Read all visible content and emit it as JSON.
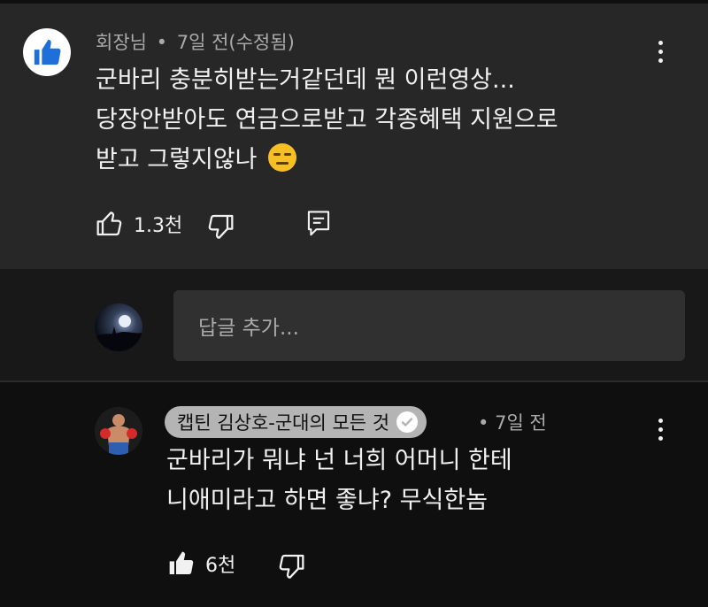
{
  "comment": {
    "author": "회장님",
    "separator": "•",
    "time": "7일 전(수정됨)",
    "lines": [
      "군바리 충분히받는거같던데 뭔 이런영상...",
      "당장안받아도 연금으로받고 각종혜택 지원으로",
      "받고 그렇지않나"
    ],
    "like_count": "1.3천",
    "avatar_icon": "thumbs-up-icon",
    "avatar_color": "#1e6fd9"
  },
  "reply_input": {
    "placeholder": "답글 추가..."
  },
  "reply": {
    "channel_name": "캡틴 김상호-군대의 모든 것",
    "separator": "•",
    "time": "7일 전",
    "lines": [
      "군바리가 뭐냐 넌 너희 어머니 한테",
      "니애미라고 하면 좋냐? 무식한놈"
    ],
    "like_count": "6천"
  },
  "colors": {
    "background": "#0f0f0f",
    "card": "#272727",
    "secondary_text": "#aaaaaa",
    "pill": "#b4b4b4"
  }
}
